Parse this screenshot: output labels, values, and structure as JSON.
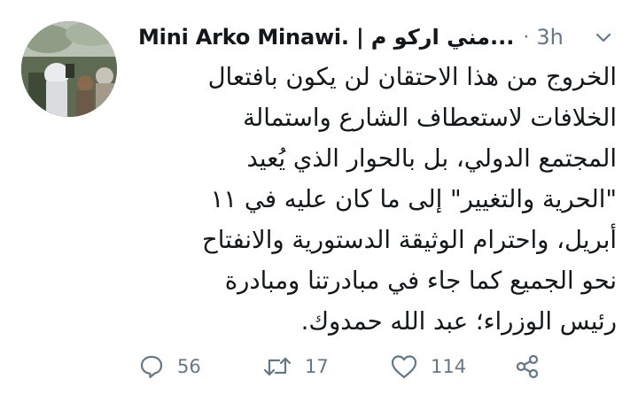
{
  "tweet": {
    "display_name": "Mini Arko Minawi. | مني اركو م...",
    "separator": "·",
    "timestamp": "3h",
    "avatar_icon": "profile-photo-crowd",
    "body_lines": [
      "الخروج من هذا الاحتقان لن يكون بافتعال",
      "الخلافات لاستعطاف الشارع واستمالة",
      "المجتمع الدولي، بل بالحوار الذي يُعيد",
      "\"الحرية والتغيير\" إلى ما كان عليه في ١١",
      "أبريل، واحترام الوثيقة الدستورية والانفتاح",
      "نحو الجميع كما جاء في مبادرتنا ومبادرة",
      "رئيس الوزراء؛ عبد الله حمدوك."
    ],
    "actions": {
      "reply_count": "56",
      "retweet_count": "17",
      "like_count": "114"
    }
  },
  "colors": {
    "text_primary": "#14171a",
    "text_secondary": "#657786",
    "background": "#ffffff"
  }
}
